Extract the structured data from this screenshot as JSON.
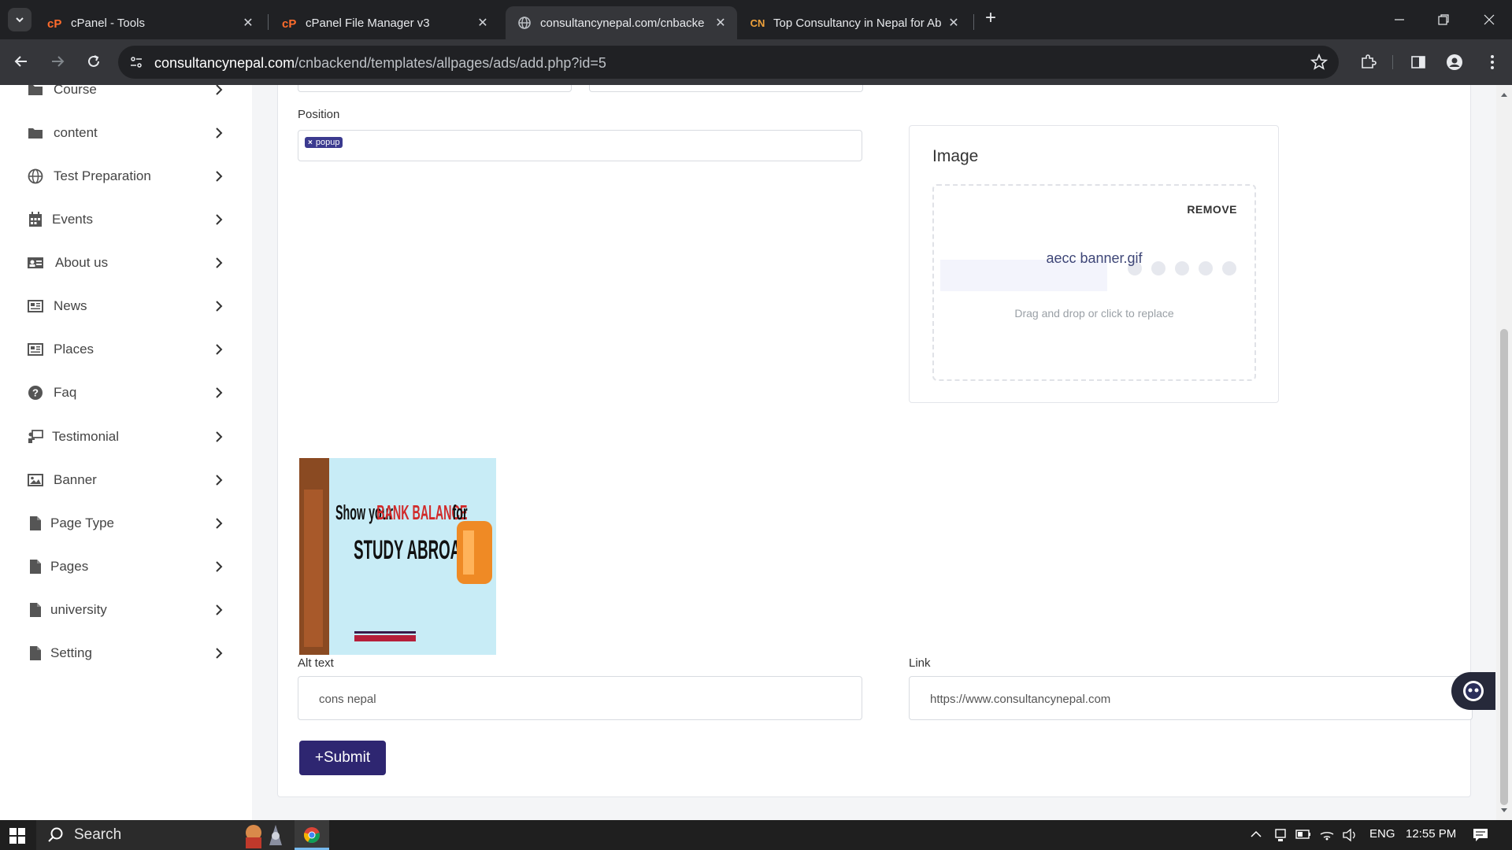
{
  "browser": {
    "tabs": [
      {
        "title": "cPanel - Tools",
        "favicon": "cpanel-icon",
        "active": false
      },
      {
        "title": "cPanel File Manager v3",
        "favicon": "cpanel-icon",
        "active": false
      },
      {
        "title": "consultancynepal.com/cnbacke",
        "favicon": "globe-icon",
        "active": true
      },
      {
        "title": "Top Consultancy in Nepal for Ab",
        "favicon": "cn-icon",
        "favicon_text": "CN",
        "active": false
      }
    ],
    "url_host": "consultancynepal.com",
    "url_path": "/cnbackend/templates/allpages/ads/add.php?id=5"
  },
  "sidebar": {
    "items": [
      {
        "label": "Course",
        "icon": "folder-icon"
      },
      {
        "label": "content",
        "icon": "folder-icon"
      },
      {
        "label": "Test Preparation",
        "icon": "globe-icon"
      },
      {
        "label": "Events",
        "icon": "calendar-icon"
      },
      {
        "label": "About us",
        "icon": "id-card-icon"
      },
      {
        "label": "News",
        "icon": "newspaper-icon"
      },
      {
        "label": "Places",
        "icon": "newspaper-icon"
      },
      {
        "label": "Faq",
        "icon": "question-icon"
      },
      {
        "label": "Testimonial",
        "icon": "person-chalkboard-icon"
      },
      {
        "label": "Banner",
        "icon": "image-icon"
      },
      {
        "label": "Page Type",
        "icon": "file-icon"
      },
      {
        "label": "Pages",
        "icon": "file-icon"
      },
      {
        "label": "university",
        "icon": "file-icon"
      },
      {
        "label": "Setting",
        "icon": "file-icon"
      }
    ]
  },
  "form": {
    "position_label": "Position",
    "position_tag": "popup",
    "image_title": "Image",
    "remove_label": "REMOVE",
    "file_name": "aecc banner.gif",
    "drag_text": "Drag and drop or click to replace",
    "alt_label": "Alt text",
    "alt_value": "cons nepal",
    "link_label": "Link",
    "link_value": "https://www.consultancynepal.com",
    "submit_label": "+Submit"
  },
  "taskbar": {
    "search_label": "Search",
    "lang": "ENG",
    "time": "12:55 PM"
  },
  "colors": {
    "accent": "#2e2671",
    "tag": "#3b3a8f",
    "chrome_dark": "#202124"
  }
}
